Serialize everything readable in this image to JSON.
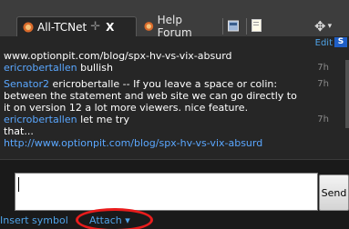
{
  "tabs": [
    {
      "label": "All-TCNet",
      "close": "X"
    },
    {
      "label": "Help Forum"
    }
  ],
  "messages_header": {
    "edit": "Edit",
    "s": "S"
  },
  "messages": [
    {
      "line": "www.optionpit.com/blog/spx-hv-vs-vix-absurd"
    },
    {
      "name": "ericrobertallen",
      "text": " bullish",
      "time": "7h"
    },
    {
      "name": "Senator2",
      "text": " ericrobertalle -- If you leave a space    or colin:",
      "time": "7h"
    },
    {
      "line": "between the statement and web site we can go directly to"
    },
    {
      "line": "it on version 12 a lot more viewers. nice feature."
    },
    {
      "name": "ericrobertallen",
      "text": " let me try",
      "time": "7h"
    },
    {
      "line": "that..."
    },
    {
      "line": " http://www.optionpit.com/blog/spx-hv-vs-vix-absurd"
    }
  ],
  "composer": {
    "send_label": "Send",
    "insert_label": "Insert symbol",
    "attach_label": "Attach ▾"
  },
  "colors": {
    "link": "#4fa3e8",
    "username": "#5aa7ff",
    "highlight_circle": "#e81c1c"
  }
}
